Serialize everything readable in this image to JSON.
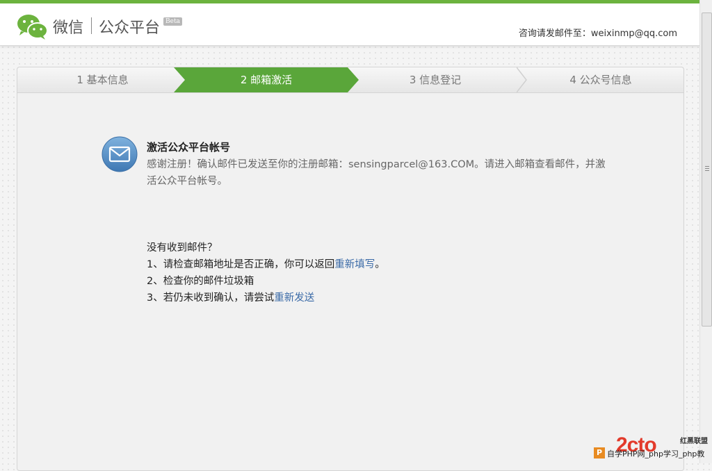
{
  "header": {
    "brand_name": "微信",
    "brand_platform": "公众平台",
    "beta": "Beta",
    "contact": "咨询请发邮件至：weixinmp@qq.com"
  },
  "steps": [
    {
      "label": "1 基本信息",
      "active": false
    },
    {
      "label": "2 邮箱激活",
      "active": true
    },
    {
      "label": "3 信息登记",
      "active": false
    },
    {
      "label": "4 公众号信息",
      "active": false
    }
  ],
  "message": {
    "title": "激活公众平台帐号",
    "body": "感谢注册！确认邮件已发送至你的注册邮箱：sensingparcel@163.COM。请进入邮箱查看邮件，并激活公众平台帐号。"
  },
  "help": {
    "question": "没有收到邮件？",
    "item1_prefix": "1、请检查邮箱地址是否正确，你可以返回",
    "item1_link": "重新填写",
    "item1_suffix": "。",
    "item2": "2、检查你的邮件垃圾箱",
    "item3_prefix": "3、若仍未收到确认，请尝试",
    "item3_link": "重新发送"
  },
  "watermark": {
    "logo": "2cto",
    "tag": "红黑联盟",
    "box": "P",
    "text": "自学PHP网_php学习_php教"
  },
  "colors": {
    "accent_green": "#6cb33e",
    "link_blue": "#3a6aa7"
  }
}
